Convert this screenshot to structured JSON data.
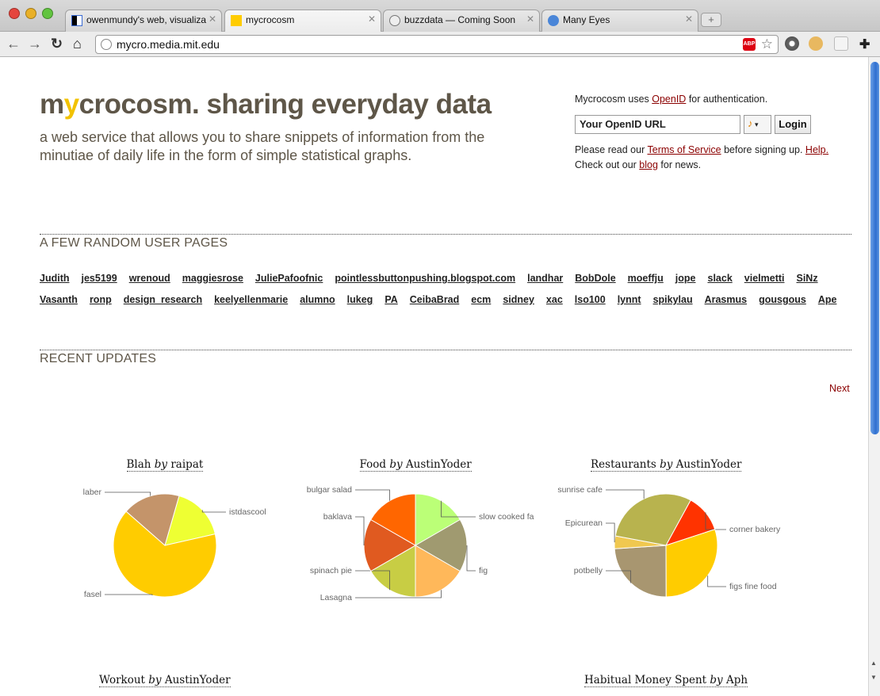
{
  "browser": {
    "tabs": [
      {
        "label": "owenmundy's web, visualiza"
      },
      {
        "label": "mycrocosm"
      },
      {
        "label": "buzzdata — Coming Soon"
      },
      {
        "label": "Many Eyes"
      }
    ],
    "newtab": "+",
    "url": "mycro.media.mit.edu",
    "abp": "ABP"
  },
  "header": {
    "logo_m": "m",
    "logo_y": "y",
    "logo_rest": "crocosm. sharing everyday data",
    "tagline": "a web service that allows you to share snippets of information from the minutiae of daily life in the form of simple statistical graphs."
  },
  "auth": {
    "intro_pre": "Mycrocosm uses ",
    "intro_link": "OpenID",
    "intro_post": " for authentication.",
    "openid_value": "Your OpenID URL",
    "login_label": "Login",
    "tos_pre": "Please read our ",
    "tos_link": "Terms of Service",
    "tos_mid": " before signing up. ",
    "help_link": "Help.",
    "blog_pre": "Check out our ",
    "blog_link": "blog",
    "blog_post": " for news."
  },
  "random_users": {
    "title": "A FEW RANDOM USER PAGES",
    "users": [
      "Judith",
      "jes5199",
      "wrenoud",
      "maggiesrose",
      "JuliePafoofnic",
      "pointlessbuttonpushing.blogspot.com",
      "landhar",
      "BobDole",
      "moeffju",
      "jope",
      "slack",
      "vielmetti",
      "SiNz",
      "Vasanth",
      "ronp",
      "design_research",
      "keelyellenmarie",
      "alumno",
      "lukeg",
      "PA",
      "CeibaBrad",
      "ecm",
      "sidney",
      "xac",
      "lso100",
      "lynnt",
      "spikylau",
      "Arasmus",
      "gousgous",
      "Ape"
    ]
  },
  "recent": {
    "title": "RECENT UPDATES",
    "next_label": "Next",
    "by": "by"
  },
  "chart_data": [
    {
      "type": "pie",
      "title": "Blah",
      "author": "raipat",
      "slices": [
        {
          "label": "istdascool",
          "value": 17,
          "color": "#eeff33"
        },
        {
          "label": "fasel",
          "value": 65,
          "color": "#ffcc00"
        },
        {
          "label": "laber",
          "value": 18,
          "color": "#c4946a"
        }
      ]
    },
    {
      "type": "pie",
      "title": "Food",
      "author": "AustinYoder",
      "slices": [
        {
          "label": "slow cooked fa",
          "value": 1,
          "color": "#bbff77"
        },
        {
          "label": "fig",
          "value": 1,
          "color": "#a09a70"
        },
        {
          "label": "Lasagna",
          "value": 1,
          "color": "#ffb85a"
        },
        {
          "label": "spinach pie",
          "value": 1,
          "color": "#c8cd44"
        },
        {
          "label": "baklava",
          "value": 1,
          "color": "#e05a20"
        },
        {
          "label": "bulgar salad",
          "value": 1,
          "color": "#ff6600"
        }
      ]
    },
    {
      "type": "pie",
      "title": "Restaurants",
      "author": "AustinYoder",
      "slices": [
        {
          "label": "corner bakery",
          "value": 12,
          "color": "#ff3300"
        },
        {
          "label": "figs fine food",
          "value": 30,
          "color": "#ffcc00"
        },
        {
          "label": "potbelly",
          "value": 24,
          "color": "#a89670"
        },
        {
          "label": "Epicurean",
          "value": 4,
          "color": "#f0c850"
        },
        {
          "label": "sunrise cafe",
          "value": 30,
          "color": "#b8b34e"
        }
      ]
    },
    {
      "type": "pie",
      "title": "Workout",
      "author": "AustinYoder",
      "slices": []
    },
    {
      "type": "pie",
      "title": "Habitual Money Spent",
      "author": "Aph",
      "slices": []
    }
  ]
}
